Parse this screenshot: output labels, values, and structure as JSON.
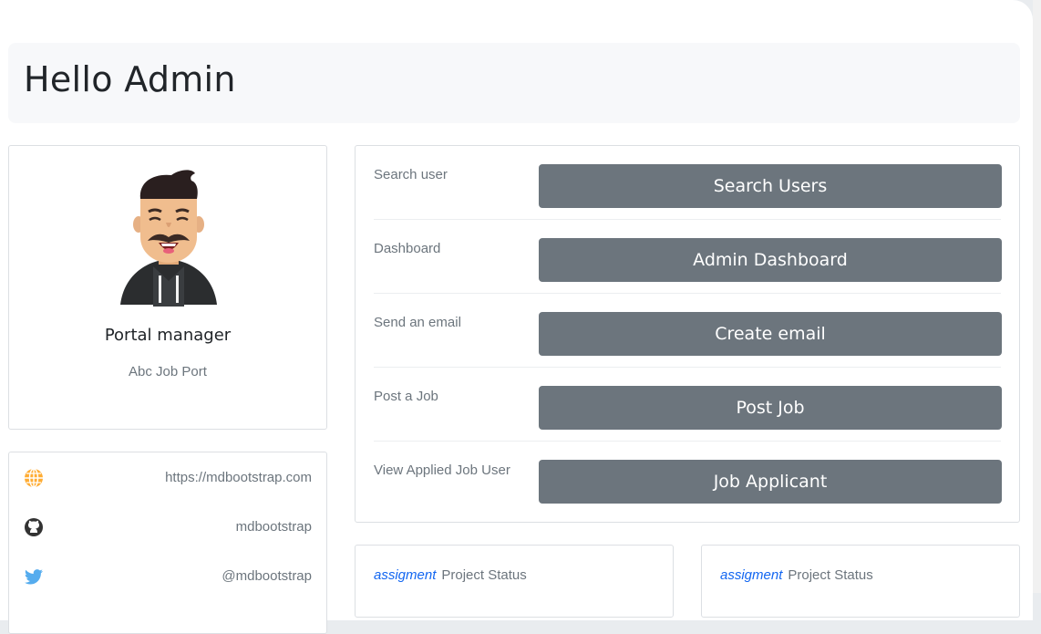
{
  "header": {
    "title": "Hello Admin"
  },
  "profile": {
    "name": "Portal manager",
    "company": "Abc Job Port"
  },
  "links": [
    {
      "icon": "globe-icon",
      "text": "https://mdbootstrap.com",
      "color": "#ffac33"
    },
    {
      "icon": "github-icon",
      "text": "mdbootstrap",
      "color": "#333333"
    },
    {
      "icon": "twitter-icon",
      "text": "@mdbootstrap",
      "color": "#55acee"
    }
  ],
  "actions": [
    {
      "label": "Search user",
      "button": "Search Users"
    },
    {
      "label": "Dashboard",
      "button": "Admin Dashboard"
    },
    {
      "label": "Send an email",
      "button": "Create email"
    },
    {
      "label": "Post a Job",
      "button": "Post Job"
    },
    {
      "label": "View Applied Job User",
      "button": "Job Applicant"
    }
  ],
  "status_cards": [
    {
      "tag": "assigment",
      "title": "Project Status"
    },
    {
      "tag": "assigment",
      "title": "Project Status"
    }
  ],
  "colors": {
    "button": "#6c757d",
    "accent": "#1266f1",
    "header_bg": "#f7f8fa"
  }
}
